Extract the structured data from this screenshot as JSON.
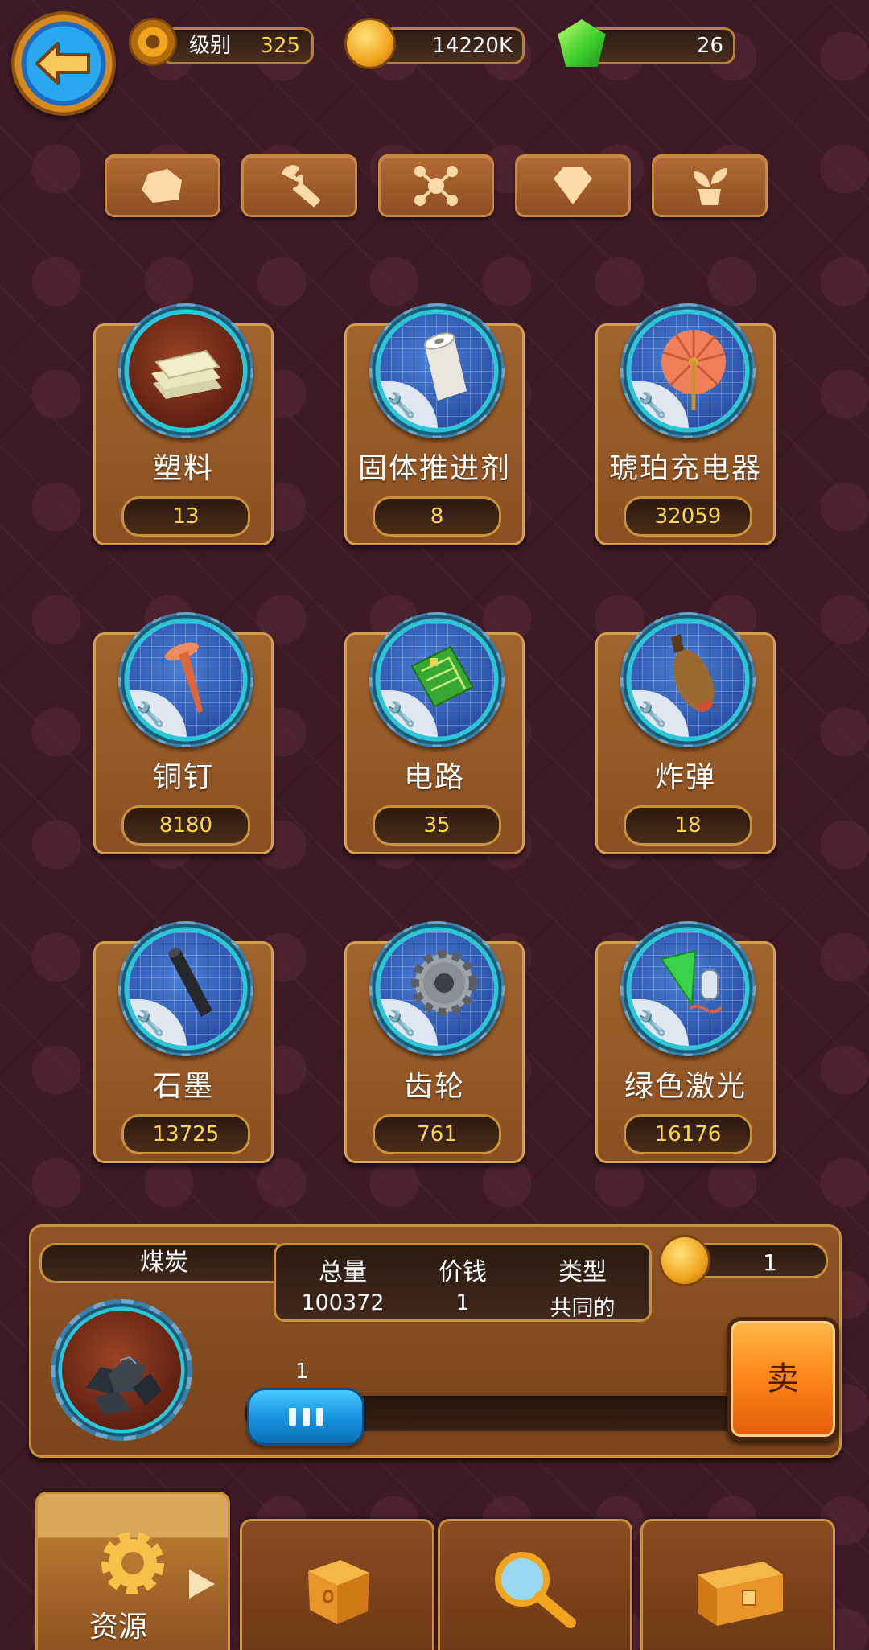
{
  "header": {
    "back_icon": "back-arrow-icon",
    "level_label": "级别",
    "level_value": "325",
    "coins": "14220K",
    "gems": "26"
  },
  "categories": [
    {
      "icon": "ore-icon"
    },
    {
      "icon": "wrench-icon"
    },
    {
      "icon": "molecule-icon"
    },
    {
      "icon": "diamond-icon"
    },
    {
      "icon": "plant-icon"
    }
  ],
  "items": [
    {
      "name": "塑料",
      "count": "13",
      "icon": "plastic-icon"
    },
    {
      "name": "固体推进剂",
      "count": "8",
      "icon": "solid-propellant-icon"
    },
    {
      "name": "琥珀充电器",
      "count": "32059",
      "icon": "amber-charger-icon"
    },
    {
      "name": "铜钉",
      "count": "8180",
      "icon": "copper-nail-icon"
    },
    {
      "name": "电路",
      "count": "35",
      "icon": "circuit-icon"
    },
    {
      "name": "炸弹",
      "count": "18",
      "icon": "bomb-icon"
    },
    {
      "name": "石墨",
      "count": "13725",
      "icon": "graphite-icon"
    },
    {
      "name": "齿轮",
      "count": "761",
      "icon": "gear-icon"
    },
    {
      "name": "绿色激光",
      "count": "16176",
      "icon": "green-laser-icon"
    }
  ],
  "detail": {
    "name": "煤炭",
    "total_label": "总量",
    "total_value": "100372",
    "price_label": "价钱",
    "price_value": "1",
    "type_label": "类型",
    "type_value": "共同的",
    "sell_price": "1",
    "slider_value": "1",
    "sell_label": "卖"
  },
  "bottom_nav": [
    {
      "label": "资源",
      "icon": "gear-icon",
      "active": true
    },
    {
      "label": "",
      "icon": "dice-icon"
    },
    {
      "label": "",
      "icon": "magnifier-icon"
    },
    {
      "label": "",
      "icon": "chest-icon"
    }
  ],
  "colors": {
    "background": "#3d1a26",
    "card": "#9a5c2a",
    "count_text": "#ffd64a",
    "sell_button": "#ff8a1a",
    "slider": "#1690dd"
  }
}
